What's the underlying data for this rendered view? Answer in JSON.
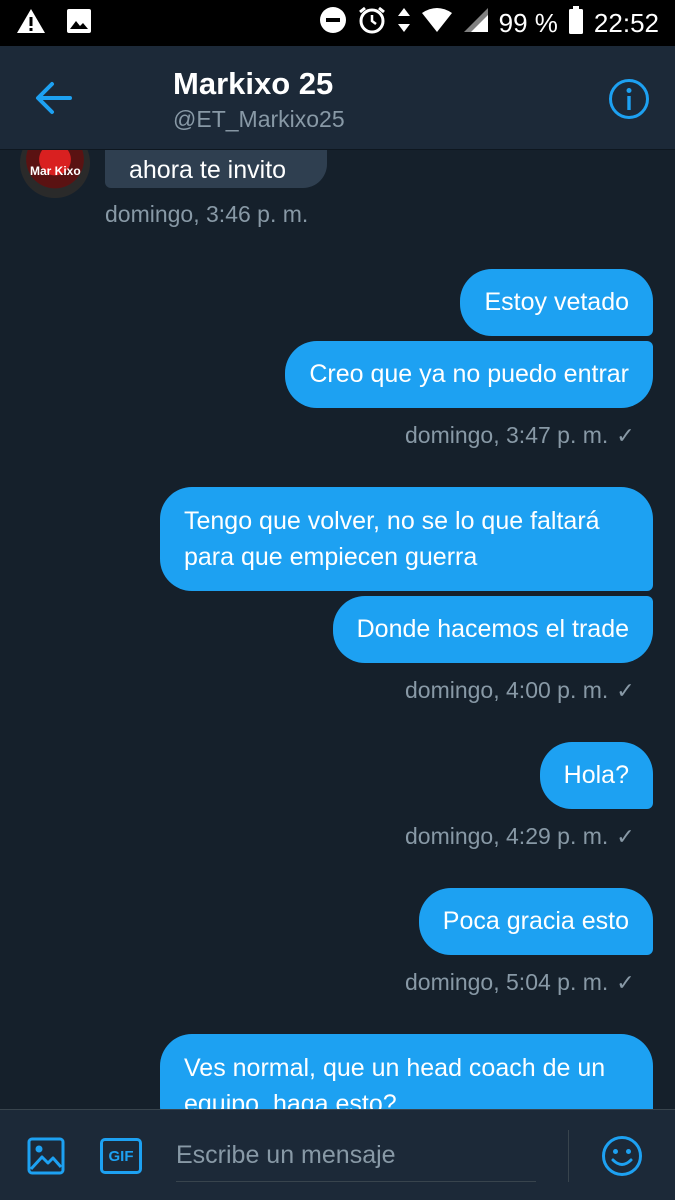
{
  "status_bar": {
    "battery": "99 %",
    "time": "22:52",
    "icons": [
      "warning-icon",
      "image-icon",
      "do-not-disturb-icon",
      "alarm-icon",
      "data-arrows-icon",
      "wifi-icon",
      "signal-icon",
      "battery-icon"
    ]
  },
  "header": {
    "name": "Markixo 25",
    "handle": "@ET_Markixo25",
    "back_icon": "arrow-left-icon",
    "info_icon": "info-icon"
  },
  "conversation": {
    "received_partial": "ahora te invito",
    "received_time": "domingo, 3:46 p. m.",
    "groups": [
      {
        "messages": [
          "Estoy vetado",
          "Creo que ya no puedo entrar"
        ],
        "time": "domingo, 3:47 p. m."
      },
      {
        "messages": [
          "Tengo que volver, no se lo que faltará para que empiecen guerra",
          "Donde hacemos el trade"
        ],
        "time": "domingo, 4:00 p. m."
      },
      {
        "messages": [
          "Hola?"
        ],
        "time": "domingo, 4:29 p. m."
      },
      {
        "messages": [
          "Poca gracia esto"
        ],
        "time": "domingo, 5:04 p. m."
      },
      {
        "messages": [
          "Ves normal, que un head coach de un equipo, haga esto?"
        ],
        "time": ""
      }
    ],
    "read_mark": "✓"
  },
  "composer": {
    "placeholder": "Escribe un mensaje",
    "gif_label": "GIF"
  },
  "colors": {
    "background": "#15202b",
    "header": "#1c2938",
    "accent": "#1da1f2",
    "received_bubble": "#2f3f50",
    "muted_text": "#8899a6"
  }
}
